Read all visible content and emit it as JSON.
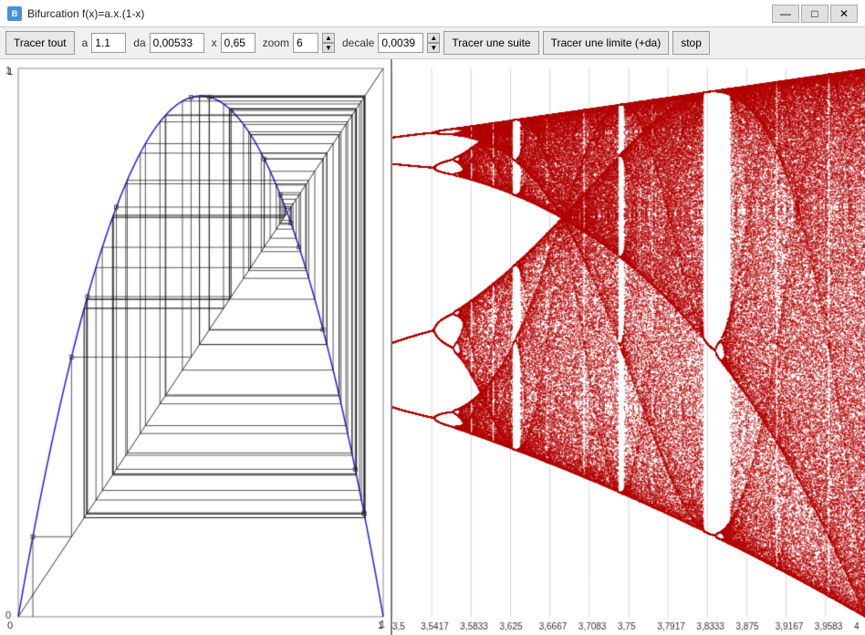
{
  "window": {
    "title": "Bifurcation  f(x)=a.x.(1-x)",
    "icon_label": "B"
  },
  "titlebar": {
    "minimize": "—",
    "maximize": "□",
    "close": "✕"
  },
  "toolbar": {
    "tracer_tout": "Tracer tout",
    "label_a": "a",
    "value_a": "1.1",
    "label_da": "da",
    "value_da": "0,00533",
    "label_x": "x",
    "value_x": "0,65",
    "label_zoom": "zoom",
    "value_zoom": "6",
    "label_decale": "decale",
    "value_decale": "0,0039",
    "btn_suite": "Tracer une suite",
    "btn_limite": "Tracer une limite (+da)",
    "btn_stop": "stop"
  },
  "left_panel": {
    "axis_y_label": "1",
    "axis_x_start": "0",
    "axis_x_end": "1"
  },
  "right_panel": {
    "x_labels": [
      "3,5",
      "3,5417",
      "3,5833",
      "3,625",
      "3,6667",
      "3,7083",
      "3,75",
      "3,7917",
      "3,8333",
      "3,875",
      "3,9167",
      "3,9583",
      "4"
    ],
    "grid_lines": 12
  }
}
